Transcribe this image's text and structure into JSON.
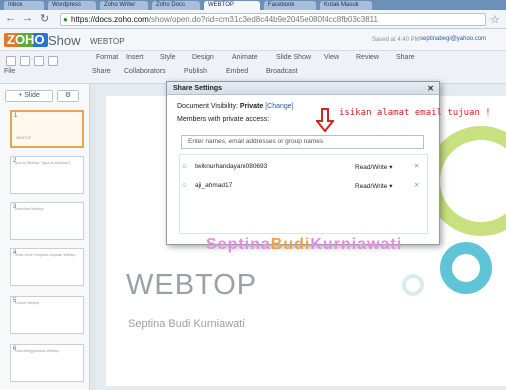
{
  "browser": {
    "tabs": [
      "Inbox",
      "Wordpress",
      "Zoho Writer",
      "Zoho Docs",
      "WEBTOP",
      "Facebook",
      "Kotak Masuk"
    ],
    "url_host": "https://docs.zoho.com",
    "url_path": "/show/open.do?rid=cm31c3ed8c44b9e2045e080f4cc8fb03c3811"
  },
  "app": {
    "logo_text": "ZOHO",
    "name": "Show",
    "document": "WEBTOP",
    "saved_text": "Saved at 4:40 PM",
    "user_email": "septinabegi@yahoo.com"
  },
  "toolbar": {
    "menus": [
      "Format",
      "Insert",
      "Style",
      "Design",
      "Animate",
      "Slide Show",
      "View",
      "Review",
      "Share"
    ],
    "file_label": "File",
    "share_label": "Share",
    "collab_label": "Collaborators",
    "publish_label": "Publish",
    "embed_label": "Embed",
    "broadcast_label": "Broadcast"
  },
  "sidebar": {
    "slide_button": "+ Slide",
    "slides": [
      {
        "num": "1",
        "text": "WEBTOP"
      },
      {
        "num": "2",
        "text": "Apa itu Webtop? (Apa itu Desktop?)"
      },
      {
        "num": "3",
        "text": "Kelebihan Webtop"
      },
      {
        "num": "4",
        "text": "Jenis-Jenis Penyedia Layanan Webtop"
      },
      {
        "num": "5",
        "text": "Contoh Webtop"
      },
      {
        "num": "6",
        "text": "Cara Menggunakan Webtop"
      }
    ]
  },
  "slide": {
    "title": "WEBTOP",
    "subtitle": "Septina Budi Kurniawati"
  },
  "dialog": {
    "title": "Share Settings",
    "visibility_label": "Document Visibility:",
    "visibility_value": "Private",
    "change_link": "[Change]",
    "members_label": "Members with private access:",
    "invite_placeholder": "Enter names, email addresses or group names",
    "members": [
      {
        "name": "twiknurhandayani080693",
        "permission": "Read/Write"
      },
      {
        "name": "aji_ahmad17",
        "permission": "Read/Write"
      }
    ]
  },
  "annotation": {
    "hint": "isikan alamat email tujuan !"
  },
  "watermark": {
    "part1": "Septina",
    "part2": "Budi",
    "part3": "Kurniawati"
  }
}
